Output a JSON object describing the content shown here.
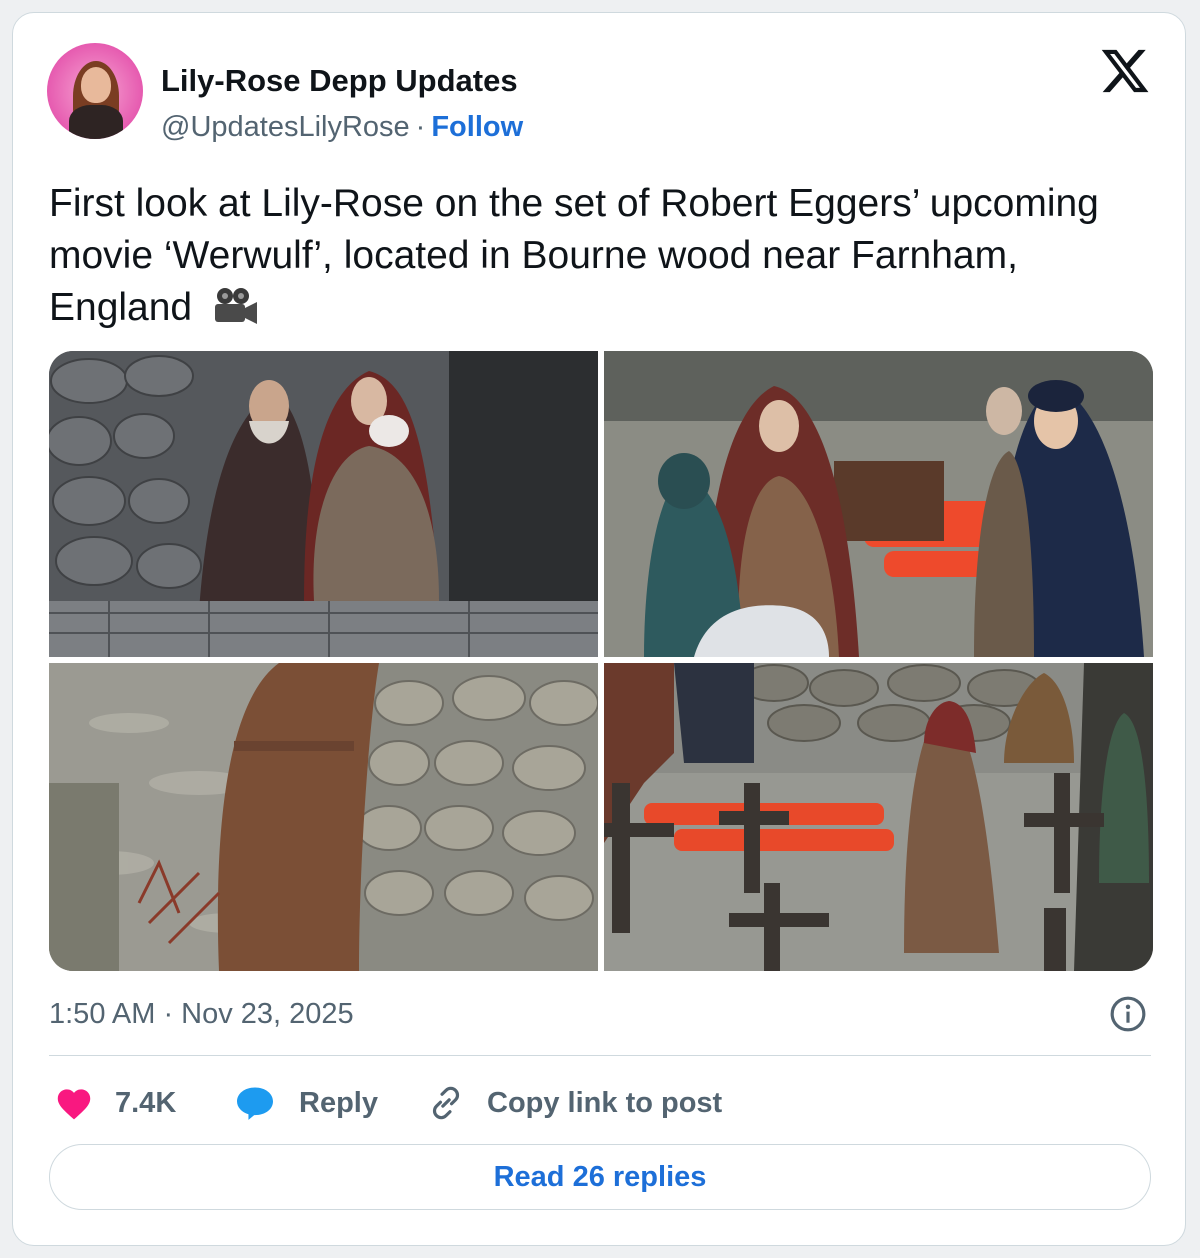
{
  "author": {
    "name": "Lily-Rose Depp Updates",
    "handle": "@UpdatesLilyRose",
    "separator": "·",
    "follow_label": "Follow"
  },
  "brand": {
    "logo_icon": "x-logo-icon"
  },
  "tweet": {
    "text": "First look at Lily-Rose on the set of Robert Eggers’ upcoming movie ‘Werwulf’, located in Bourne wood near Farnham, England",
    "emoji_icon": "film-camera-icon",
    "timestamp": "1:50 AM · Nov 23, 2025"
  },
  "photos": [
    {
      "id": "photo-1",
      "icon": "photo"
    },
    {
      "id": "photo-2",
      "icon": "photo"
    },
    {
      "id": "photo-3",
      "icon": "photo"
    },
    {
      "id": "photo-4",
      "icon": "photo"
    }
  ],
  "actions": {
    "likes": "7.4K",
    "reply_label": "Reply",
    "copy_label": "Copy link to post"
  },
  "read_replies_label": "Read 26 replies",
  "colors": {
    "accent": "#1d6fd8",
    "like": "#f91880",
    "reply": "#1d9bf0",
    "text": "#0f1419",
    "muted": "#536471"
  }
}
